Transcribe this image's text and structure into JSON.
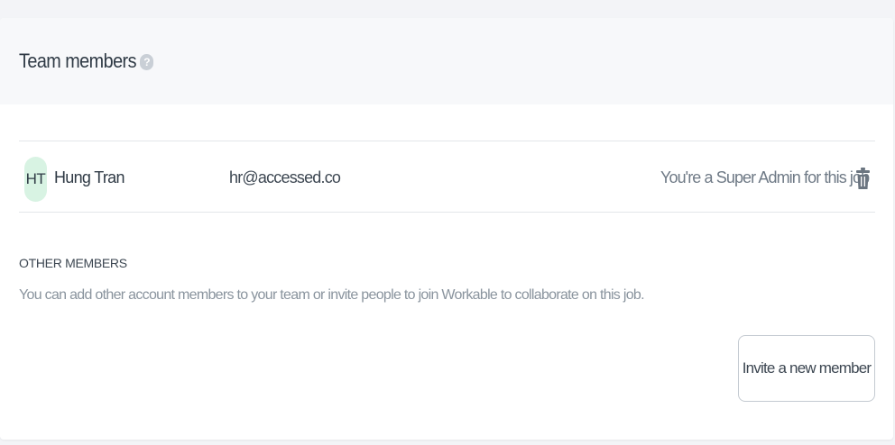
{
  "panel": {
    "title": "Team members",
    "help_icon": "question-mark-icon"
  },
  "members": [
    {
      "initials": "HT",
      "name": "Hung Tran",
      "email": "hr@accessed.co",
      "role_note": "You're a Super Admin for this job",
      "delete_icon": "trash-icon",
      "avatar_color": "#d8f3e3"
    }
  ],
  "other_members": {
    "title": "OTHER MEMBERS",
    "description": "You can add other account members to your team or invite people to join Workable to collaborate on this job.",
    "invite_button_label": "Invite a new member"
  },
  "colors": {
    "header_background": "#f7f8fa",
    "text_primary": "#2f3a45",
    "text_muted": "#8a949e",
    "icon_gray": "#6b7580"
  }
}
